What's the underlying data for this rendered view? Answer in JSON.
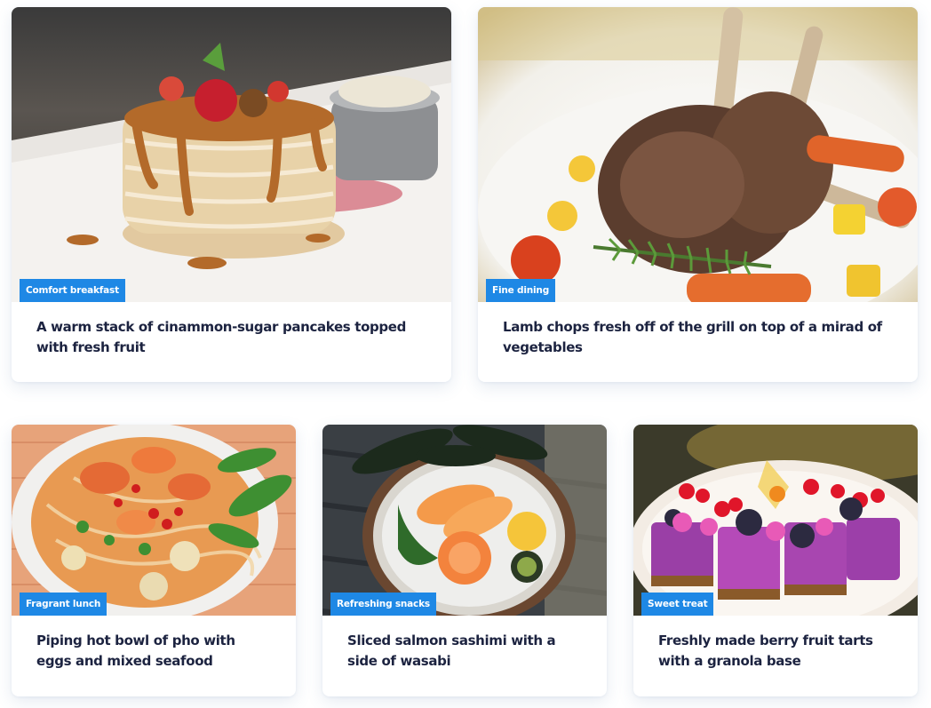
{
  "cards": [
    {
      "badge": "Comfort breakfast",
      "caption": "A warm stack of cinammon-sugar pancakes topped with fresh fruit",
      "image": "pancakes-photo"
    },
    {
      "badge": "Fine dining",
      "caption": "Lamb chops fresh off of the grill on top of a mirad of vegetables",
      "image": "lamb-chops-photo"
    },
    {
      "badge": "Fragrant lunch",
      "caption": "Piping hot bowl of pho with eggs and mixed seafood",
      "image": "pho-bowl-photo"
    },
    {
      "badge": "Refreshing snacks",
      "caption": "Sliced salmon sashimi with a side of wasabi",
      "image": "salmon-sashimi-photo"
    },
    {
      "badge": "Sweet treat",
      "caption": "Freshly made berry fruit tarts with a granola base",
      "image": "berry-tarts-photo"
    }
  ],
  "colors": {
    "badge_background": "#1e88e5",
    "badge_text": "#ffffff",
    "caption_text": "#1c2340",
    "card_background": "#ffffff"
  }
}
